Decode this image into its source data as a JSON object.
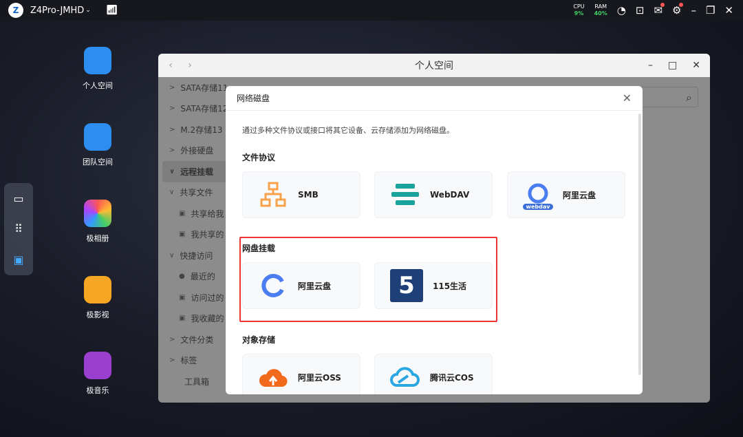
{
  "topbar": {
    "device": "Z4Pro-JMHD",
    "cpu_label": "CPU",
    "cpu_value": "9%",
    "ram_label": "RAM",
    "ram_value": "40%"
  },
  "desktop": [
    {
      "label": "个人空间",
      "color": "#2b8ef0"
    },
    {
      "label": "团队空间",
      "color": "#2b8ef0"
    },
    {
      "label": "极相册",
      "color": "#ffffff"
    },
    {
      "label": "极影视",
      "color": "#f5a623"
    },
    {
      "label": "极音乐",
      "color": "#9b3fd1"
    }
  ],
  "window": {
    "title": "个人空间",
    "search_placeholder": ""
  },
  "sidebar": [
    {
      "label": "SATA存储11",
      "arrow": ">",
      "sub": false
    },
    {
      "label": "SATA存储12",
      "arrow": ">",
      "sub": false
    },
    {
      "label": "M.2存储13",
      "arrow": ">",
      "sub": false
    },
    {
      "label": "外接硬盘",
      "arrow": ">",
      "sub": false
    },
    {
      "label": "远程挂载",
      "arrow": "∨",
      "sub": false,
      "selected": true
    },
    {
      "label": "共享文件",
      "arrow": "∨",
      "sub": false
    },
    {
      "label": "共享给我",
      "arrow": "▣",
      "sub": true
    },
    {
      "label": "我共享的",
      "arrow": "▣",
      "sub": true
    },
    {
      "label": "快捷访问",
      "arrow": "∨",
      "sub": false
    },
    {
      "label": "最近的",
      "arrow": "●",
      "sub": true
    },
    {
      "label": "访问过的",
      "arrow": "▣",
      "sub": true
    },
    {
      "label": "我收藏的",
      "arrow": "▣",
      "sub": true
    },
    {
      "label": "文件分类",
      "arrow": ">",
      "sub": false
    },
    {
      "label": "标签",
      "arrow": ">",
      "sub": false
    },
    {
      "label": "工具箱",
      "arrow": "",
      "sub": true
    }
  ],
  "dialog": {
    "title": "网络磁盘",
    "description": "通过多种文件协议或接口将其它设备、云存储添加为网络磁盘。",
    "sections": [
      {
        "title": "文件协议",
        "cards": [
          "SMB",
          "WebDAV",
          "阿里云盘"
        ]
      },
      {
        "title": "网盘挂载",
        "cards": [
          "阿里云盘",
          "115生活"
        ]
      },
      {
        "title": "对象存储",
        "cards": [
          "阿里云OSS",
          "腾讯云COS"
        ]
      }
    ],
    "webdav_badge": "webdav",
    "logo_115": "5"
  }
}
